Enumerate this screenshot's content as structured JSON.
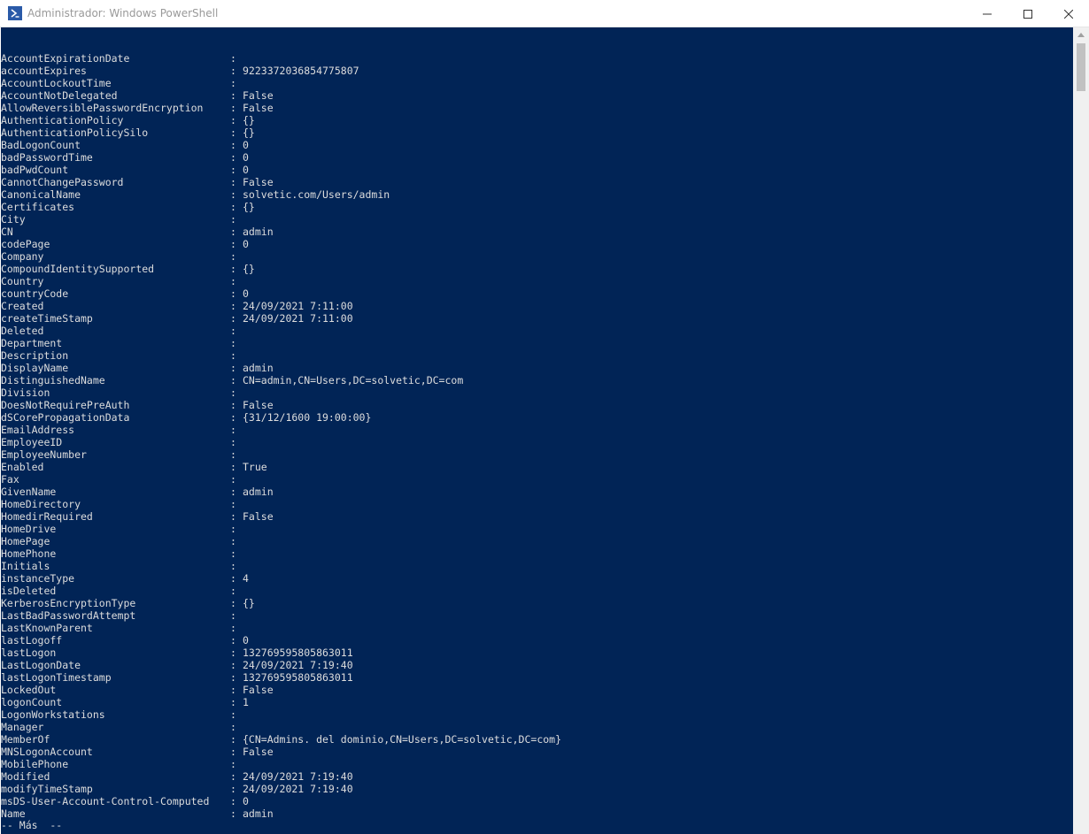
{
  "window": {
    "title": "Administrador: Windows PowerShell",
    "icon": "powershell-icon"
  },
  "controls": {
    "minimize": "minimize-icon",
    "maximize": "maximize-icon",
    "close": "close-icon"
  },
  "colors": {
    "console_bg": "#012456",
    "console_fg": "#dddddd"
  },
  "console": {
    "separator": ":",
    "properties": [
      {
        "name": "AccountExpirationDate",
        "value": ""
      },
      {
        "name": "accountExpires",
        "value": "9223372036854775807"
      },
      {
        "name": "AccountLockoutTime",
        "value": ""
      },
      {
        "name": "AccountNotDelegated",
        "value": "False"
      },
      {
        "name": "AllowReversiblePasswordEncryption",
        "value": "False"
      },
      {
        "name": "AuthenticationPolicy",
        "value": "{}"
      },
      {
        "name": "AuthenticationPolicySilo",
        "value": "{}"
      },
      {
        "name": "BadLogonCount",
        "value": "0"
      },
      {
        "name": "badPasswordTime",
        "value": "0"
      },
      {
        "name": "badPwdCount",
        "value": "0"
      },
      {
        "name": "CannotChangePassword",
        "value": "False"
      },
      {
        "name": "CanonicalName",
        "value": "solvetic.com/Users/admin"
      },
      {
        "name": "Certificates",
        "value": "{}"
      },
      {
        "name": "City",
        "value": ""
      },
      {
        "name": "CN",
        "value": "admin"
      },
      {
        "name": "codePage",
        "value": "0"
      },
      {
        "name": "Company",
        "value": ""
      },
      {
        "name": "CompoundIdentitySupported",
        "value": "{}"
      },
      {
        "name": "Country",
        "value": ""
      },
      {
        "name": "countryCode",
        "value": "0"
      },
      {
        "name": "Created",
        "value": "24/09/2021 7:11:00"
      },
      {
        "name": "createTimeStamp",
        "value": "24/09/2021 7:11:00"
      },
      {
        "name": "Deleted",
        "value": ""
      },
      {
        "name": "Department",
        "value": ""
      },
      {
        "name": "Description",
        "value": ""
      },
      {
        "name": "DisplayName",
        "value": "admin"
      },
      {
        "name": "DistinguishedName",
        "value": "CN=admin,CN=Users,DC=solvetic,DC=com"
      },
      {
        "name": "Division",
        "value": ""
      },
      {
        "name": "DoesNotRequirePreAuth",
        "value": "False"
      },
      {
        "name": "dSCorePropagationData",
        "value": "{31/12/1600 19:00:00}"
      },
      {
        "name": "EmailAddress",
        "value": ""
      },
      {
        "name": "EmployeeID",
        "value": ""
      },
      {
        "name": "EmployeeNumber",
        "value": ""
      },
      {
        "name": "Enabled",
        "value": "True"
      },
      {
        "name": "Fax",
        "value": ""
      },
      {
        "name": "GivenName",
        "value": "admin"
      },
      {
        "name": "HomeDirectory",
        "value": ""
      },
      {
        "name": "HomedirRequired",
        "value": "False"
      },
      {
        "name": "HomeDrive",
        "value": ""
      },
      {
        "name": "HomePage",
        "value": ""
      },
      {
        "name": "HomePhone",
        "value": ""
      },
      {
        "name": "Initials",
        "value": ""
      },
      {
        "name": "instanceType",
        "value": "4"
      },
      {
        "name": "isDeleted",
        "value": ""
      },
      {
        "name": "KerberosEncryptionType",
        "value": "{}"
      },
      {
        "name": "LastBadPasswordAttempt",
        "value": ""
      },
      {
        "name": "LastKnownParent",
        "value": ""
      },
      {
        "name": "lastLogoff",
        "value": "0"
      },
      {
        "name": "lastLogon",
        "value": "132769595805863011"
      },
      {
        "name": "LastLogonDate",
        "value": "24/09/2021 7:19:40"
      },
      {
        "name": "lastLogonTimestamp",
        "value": "132769595805863011"
      },
      {
        "name": "LockedOut",
        "value": "False"
      },
      {
        "name": "logonCount",
        "value": "1"
      },
      {
        "name": "LogonWorkstations",
        "value": ""
      },
      {
        "name": "Manager",
        "value": ""
      },
      {
        "name": "MemberOf",
        "value": "{CN=Admins. del dominio,CN=Users,DC=solvetic,DC=com}"
      },
      {
        "name": "MNSLogonAccount",
        "value": "False"
      },
      {
        "name": "MobilePhone",
        "value": ""
      },
      {
        "name": "Modified",
        "value": "24/09/2021 7:19:40"
      },
      {
        "name": "modifyTimeStamp",
        "value": "24/09/2021 7:19:40"
      },
      {
        "name": "msDS-User-Account-Control-Computed",
        "value": "0"
      },
      {
        "name": "Name",
        "value": "admin"
      }
    ],
    "more_prompt": "-- Más  --"
  },
  "scrollbar": {
    "up_icon": "scroll-up-arrow-icon"
  }
}
